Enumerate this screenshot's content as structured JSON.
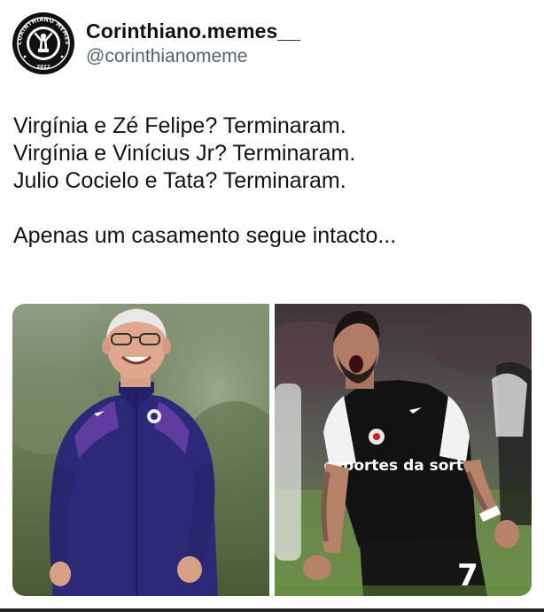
{
  "author": {
    "display_name": "Corinthiano.memes__",
    "handle": "@corinthianomeme",
    "avatar_text": "CORINTHIANO MEMES",
    "avatar_year": "2022"
  },
  "tweet": {
    "lines": [
      "Virgínia e Zé Felipe? Terminaram.",
      "Virgínia e Vinícius Jr? Terminaram.",
      "Julio Cocielo e Tata? Terminaram.",
      "Apenas um casamento segue intacto..."
    ]
  },
  "media": {
    "right_photo": {
      "sponsor_text": "esportes da sorte",
      "shirt_number": "7"
    }
  }
}
